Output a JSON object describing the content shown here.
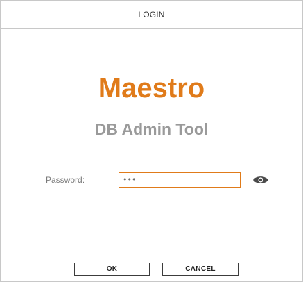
{
  "window": {
    "title": "LOGIN"
  },
  "branding": {
    "app_name": "Maestro",
    "subtitle": "DB Admin Tool",
    "accent_color": "#e07b1a",
    "subtitle_color": "#9a9a9a"
  },
  "form": {
    "password_label": "Password:",
    "password_masked_value": "•••",
    "toggle_icon": "eye-icon"
  },
  "buttons": {
    "ok_label": "OK",
    "cancel_label": "CANCEL"
  }
}
